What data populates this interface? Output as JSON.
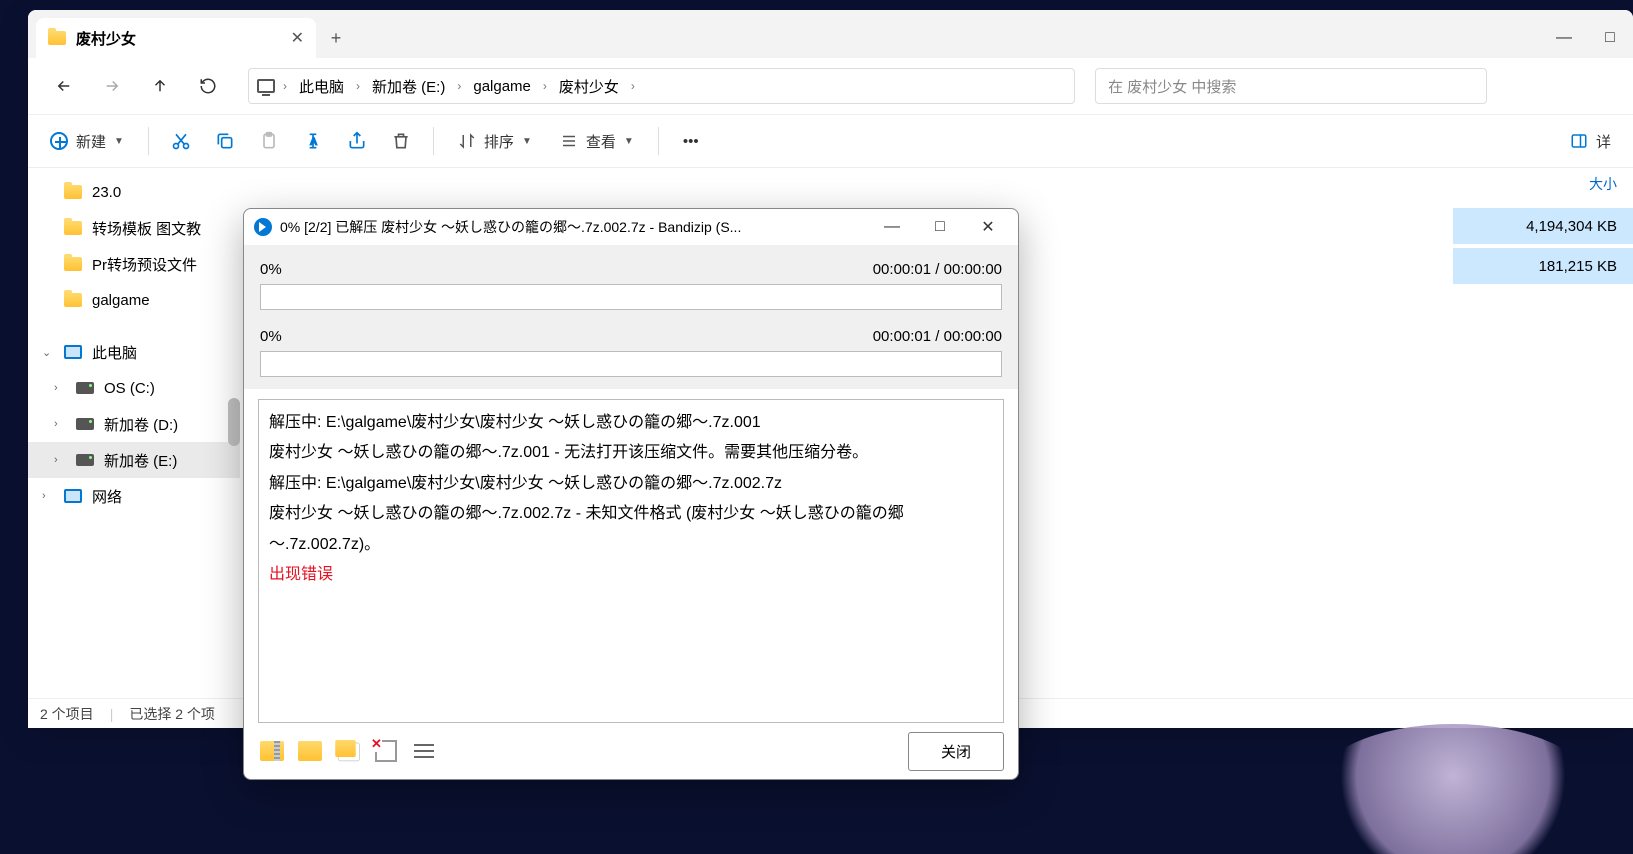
{
  "tab": {
    "title": "废村少女"
  },
  "window_controls": {
    "min": "—",
    "max": "□",
    "close": "✕"
  },
  "nav": {
    "breadcrumb": [
      "此电脑",
      "新加卷 (E:)",
      "galgame",
      "废村少女"
    ],
    "search_placeholder": "在 废村少女 中搜索"
  },
  "toolbar": {
    "new": "新建",
    "sort": "排序",
    "view": "查看",
    "details": "详"
  },
  "sidebar": {
    "folders": [
      "23.0",
      "转场模板 图文教",
      "Pr转场预设文件",
      "galgame"
    ],
    "this_pc": "此电脑",
    "drives": [
      "OS (C:)",
      "新加卷 (D:)",
      "新加卷 (E:)"
    ],
    "network": "网络"
  },
  "columns": {
    "size": "大小"
  },
  "files": [
    {
      "size": "4,194,304 KB"
    },
    {
      "size": "181,215 KB"
    }
  ],
  "status": {
    "count": "2 个项目",
    "selection": "已选择 2 个项"
  },
  "dialog": {
    "title": "0% [2/2] 已解压 废村少女 ～妖し惑ひの籠の郷～.7z.002.7z - Bandizip (S...",
    "progress1": {
      "pct": "0%",
      "time": "00:00:01 / 00:00:00"
    },
    "progress2": {
      "pct": "0%",
      "time": "00:00:01 / 00:00:00"
    },
    "log": [
      "解压中: E:\\galgame\\废村少女\\废村少女 ～妖し惑ひの籠の郷～.7z.001",
      "废村少女 ～妖し惑ひの籠の郷～.7z.001 - 无法打开该压缩文件。需要其他压缩分卷。",
      "解压中: E:\\galgame\\废村少女\\废村少女 ～妖し惑ひの籠の郷～.7z.002.7z",
      "废村少女 ～妖し惑ひの籠の郷～.7z.002.7z - 未知文件格式 (废村少女 ～妖し惑ひの籠の郷～.7z.002.7z)。"
    ],
    "error": "出现错误",
    "close": "关闭"
  }
}
